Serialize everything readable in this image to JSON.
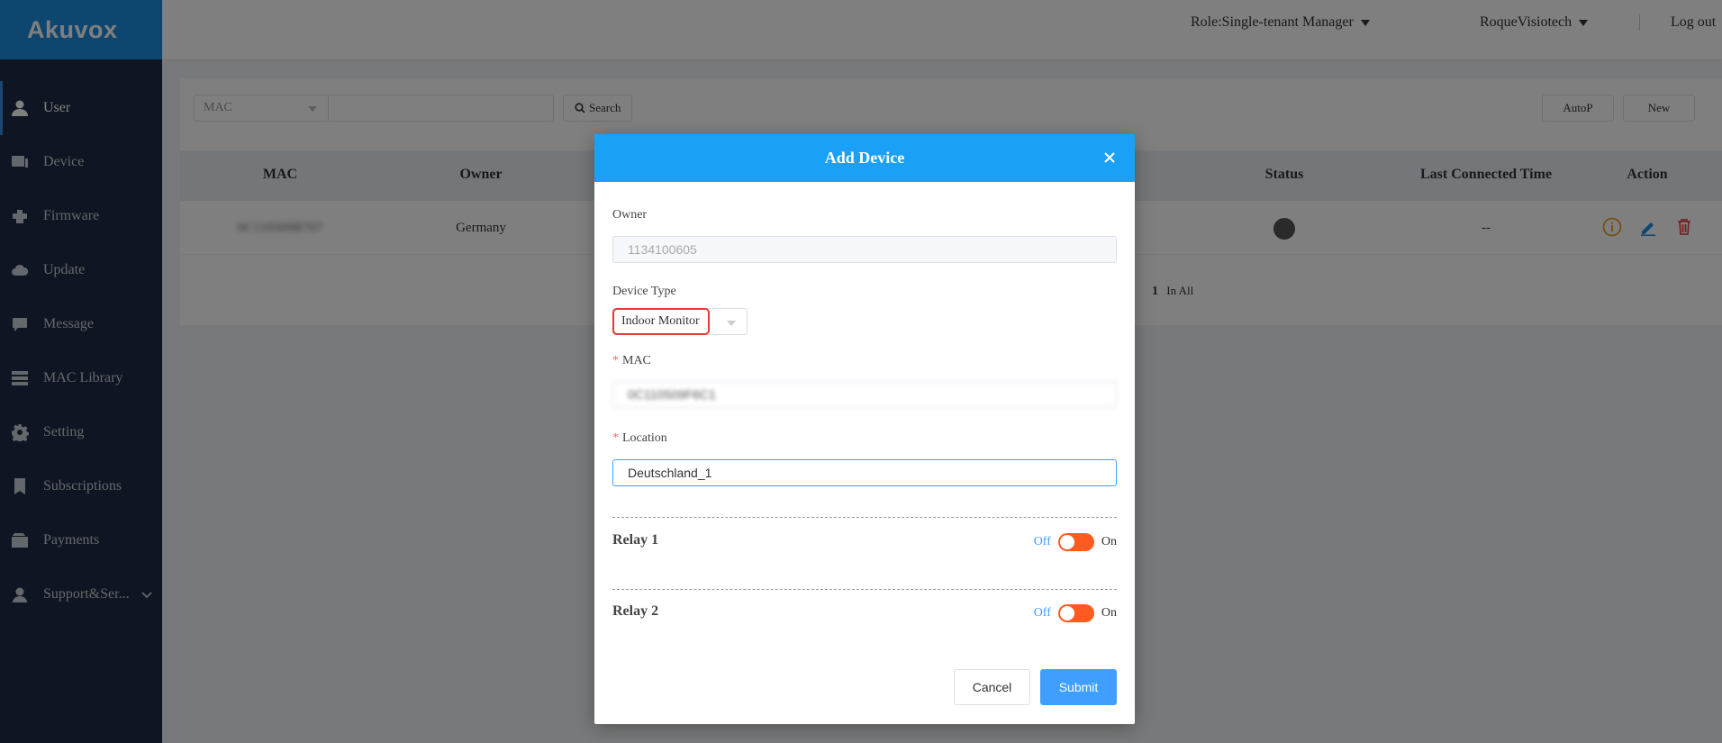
{
  "brand": {
    "name": "Akuvox",
    "color": "#1d8ce0"
  },
  "header": {
    "role": "Role:Single-tenant Manager",
    "user": "RoqueVisiotech",
    "logout": "Log out"
  },
  "sidebar": {
    "items": [
      {
        "label": "User",
        "icon": "user-icon",
        "active": true
      },
      {
        "label": "Device",
        "icon": "device-icon"
      },
      {
        "label": "Firmware",
        "icon": "firmware-icon"
      },
      {
        "label": "Update",
        "icon": "cloud-upload-icon"
      },
      {
        "label": "Message",
        "icon": "message-icon"
      },
      {
        "label": "MAC Library",
        "icon": "server-icon"
      },
      {
        "label": "Setting",
        "icon": "gear-icon"
      },
      {
        "label": "Subscriptions",
        "icon": "bookmark-icon"
      },
      {
        "label": "Payments",
        "icon": "wallet-icon"
      },
      {
        "label": "Support&Ser...",
        "icon": "support-icon"
      }
    ]
  },
  "toolbar": {
    "filter_value": "MAC",
    "search_value": "",
    "search_label": "Search",
    "autop_label": "AutoP",
    "new_label": "New"
  },
  "table": {
    "columns": [
      "MAC",
      "Owner",
      "Status",
      "Last Connected Time",
      "Action"
    ],
    "rows": [
      {
        "mac": "0C110509B707",
        "owner": "Germany",
        "status": "offline",
        "last_connected": "--"
      }
    ],
    "total_count": "1",
    "total_label": "In All"
  },
  "modal": {
    "title": "Add Device",
    "owner_label": "Owner",
    "owner_value": "1134100605",
    "device_type_label": "Device Type",
    "device_type_value": "Indoor Monitor",
    "mac_label": "MAC",
    "mac_value": "0C110509F6C1",
    "location_label": "Location",
    "location_value": "Deutschland_1",
    "relay1_label": "Relay 1",
    "relay2_label": "Relay 2",
    "off_label": "Off",
    "on_label": "On",
    "relay1_on": false,
    "relay2_on": false,
    "cancel_label": "Cancel",
    "submit_label": "Submit",
    "header_color": "#1aa1f5",
    "submit_color": "#409eff",
    "switch_color": "#ff5a1f"
  }
}
